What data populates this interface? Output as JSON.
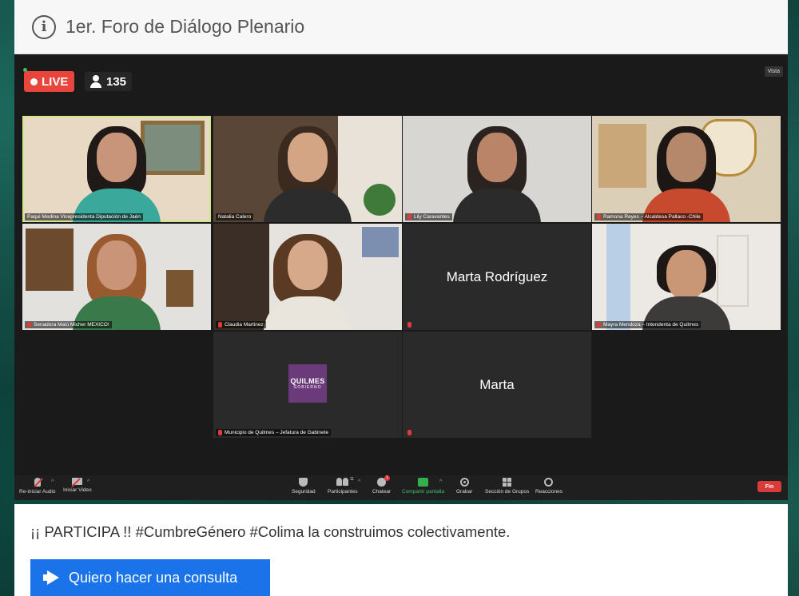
{
  "header": {
    "title": "1er. Foro de Diálogo Plenario"
  },
  "stream": {
    "live_label": "LIVE",
    "viewer_count": "135",
    "view_button": "Vista"
  },
  "participants": [
    {
      "name": "Paqui Medina Vicepresidenta Diputación de Jaén",
      "video": true,
      "muted": false,
      "active": true
    },
    {
      "name": "Natalia Calero",
      "video": true,
      "muted": false
    },
    {
      "name": "Lily Caravantes",
      "video": true,
      "muted": true
    },
    {
      "name": "Ramona Reyes – Alcaldesa Pallaco -Chile",
      "video": true,
      "muted": true
    },
    {
      "name": "Senadora Malú Micher MEXICO!",
      "video": true,
      "muted": true
    },
    {
      "name": "Claudia Martinez",
      "video": true,
      "muted": true
    },
    {
      "name": "Marta Rodríguez",
      "video": false,
      "muted": true
    },
    {
      "name": "Mayra Mendoza – Intendenta de Quilmes",
      "video": true,
      "muted": true
    },
    {
      "name": "Municipio de Quilmes – Jefatura de Gabinete",
      "video": false,
      "muted": true,
      "logo_main": "QUILMES",
      "logo_sub": "GOBIERNO"
    },
    {
      "name": "Marta",
      "video": false,
      "muted": true
    }
  ],
  "toolbar": {
    "audio": "Re-iniciar Audio",
    "video": "Iniciar Video",
    "security": "Seguridad",
    "participants": "Participantes",
    "participants_count": "11",
    "chat": "Chatear",
    "chat_badge": "1",
    "share": "Compartir pantalla",
    "record": "Grabar",
    "groups": "Sección de Grupos",
    "reactions": "Reacciones",
    "end": "Fin"
  },
  "footer": {
    "promo": "¡¡ PARTICIPA !! #CumbreGénero #Colima la construimos colectivamente.",
    "consult_button": "Quiero hacer una consulta"
  },
  "colors": {
    "live": "#e8453c",
    "share": "#33b04a",
    "end": "#d93a3a",
    "button": "#1a73e8"
  }
}
